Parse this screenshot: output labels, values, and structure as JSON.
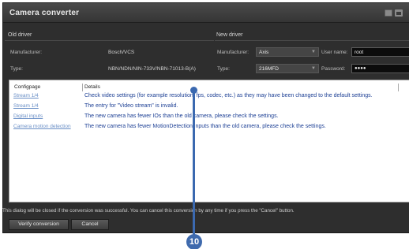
{
  "window": {
    "title": "Camera converter"
  },
  "old_driver": {
    "heading": "Old driver",
    "manufacturer_label": "Manufacturer:",
    "manufacturer_value": "Bosch/VCS",
    "type_label": "Type:",
    "type_value": "NBN/NDN/NIN-733V/NBN-71013-B(A)"
  },
  "new_driver": {
    "heading": "New driver",
    "manufacturer_label": "Manufacturer:",
    "manufacturer_value": "Axis",
    "type_label": "Type:",
    "type_value": "216MFD",
    "username_label": "User name:",
    "username_value": "root",
    "password_label": "Password:",
    "password_value": "●●●●"
  },
  "details_table": {
    "col_configpage": "Configpage",
    "col_details": "Details",
    "rows": [
      {
        "page": "Stream 1/4",
        "detail": "Check video settings (for example resolution, fps, codec, etc.) as they may have been changed to the default settings."
      },
      {
        "page": "Stream 1/4",
        "detail": "The entry for \"Video stream\" is invalid."
      },
      {
        "page": "Digital inputs",
        "detail": "The new camera has fewer IOs than the old camera, please check the settings."
      },
      {
        "page": "Camera motion detection",
        "detail": "The new camera has fewer MotionDetection inputs than the old camera, please check the settings."
      }
    ]
  },
  "footer": {
    "message": "This dialog will be closed if the conversion was successful. You can cancel this conversion by any time if you press the \"Cancel\" button.",
    "verify_label": "Verify conversion",
    "cancel_label": "Cancel"
  },
  "callout": {
    "number": "10"
  },
  "colors": {
    "accent": "#3b69b0",
    "window_bg": "#2e2e2e",
    "detail_text": "#1c3f94",
    "link_text": "#6a8fc6"
  }
}
